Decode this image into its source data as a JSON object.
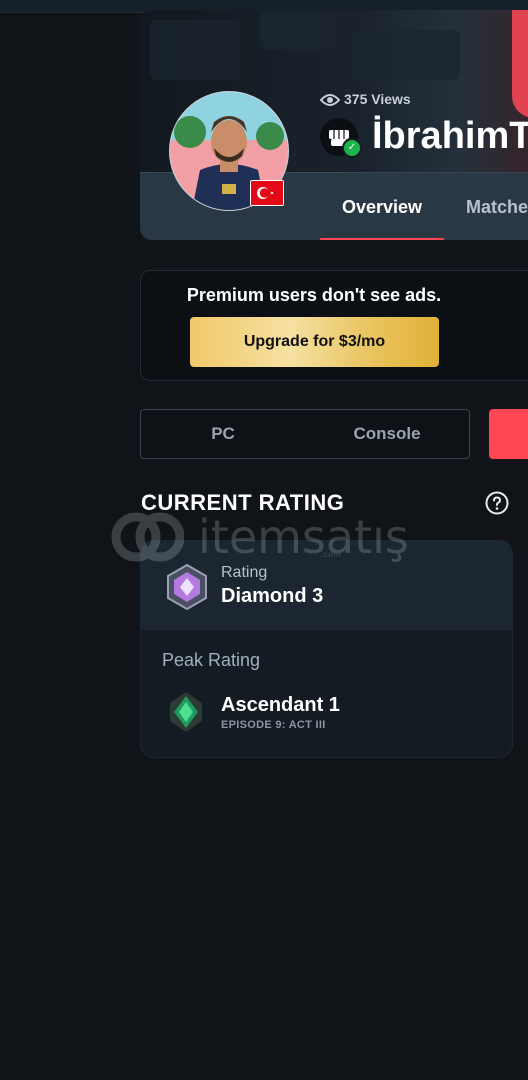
{
  "header": {
    "views_text": "375 Views",
    "player_name": "İbrahimT",
    "tabs": [
      {
        "label": "Overview",
        "active": true
      },
      {
        "label": "Matche",
        "active": false
      }
    ],
    "flag": "turkey-flag",
    "platform_badge_icon": "fist-icon",
    "accent_color": "#ff4655"
  },
  "premium": {
    "message": "Premium users don't see ads.",
    "button_label": "Upgrade for $3/mo"
  },
  "platform_toggle": {
    "options": [
      "PC",
      "Console"
    ]
  },
  "rating": {
    "section_title": "CURRENT RATING",
    "current": {
      "label": "Rating",
      "value": "Diamond 3",
      "icon": "diamond-rank-icon"
    },
    "peak": {
      "label": "Peak Rating",
      "value": "Ascendant 1",
      "episode": "EPISODE 9: ACT III",
      "icon": "ascendant-rank-icon"
    }
  },
  "watermark": {
    "text": "itemsatış",
    "sub": ".com"
  }
}
